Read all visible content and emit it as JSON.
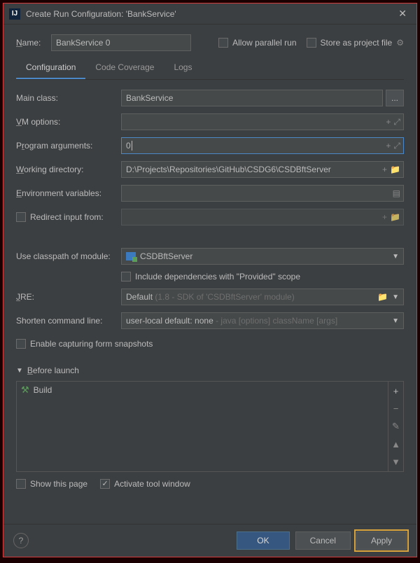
{
  "window": {
    "title": "Create Run Configuration: 'BankService'"
  },
  "header": {
    "name_label": "Name:",
    "name_value": "BankService 0",
    "allow_parallel_label": "Allow parallel run",
    "store_project_label": "Store as project file"
  },
  "tabs": {
    "items": [
      {
        "label": "Configuration",
        "active": true
      },
      {
        "label": "Code Coverage",
        "active": false
      },
      {
        "label": "Logs",
        "active": false
      }
    ]
  },
  "form": {
    "main_class_label": "Main class:",
    "main_class_value": "BankService",
    "browse_label": "...",
    "vm_options_label": "VM options:",
    "vm_options_value": "",
    "program_args_label": "Program arguments:",
    "program_args_value": "0",
    "working_dir_label": "Working directory:",
    "working_dir_value": "D:\\Projects\\Repositories\\GitHub\\CSDG6\\CSDBftServer",
    "env_vars_label": "Environment variables:",
    "env_vars_value": "",
    "redirect_input_label": "Redirect input from:",
    "classpath_label": "Use classpath of module:",
    "classpath_value": "CSDBftServer",
    "include_provided_label": "Include dependencies with \"Provided\" scope",
    "jre_label": "JRE:",
    "jre_value": "Default",
    "jre_hint": "(1.8 - SDK of 'CSDBftServer' module)",
    "shorten_label": "Shorten command line:",
    "shorten_value": "user-local default: none",
    "shorten_hint": "- java [options] className [args]",
    "enable_snapshots_label": "Enable capturing form snapshots"
  },
  "before_launch": {
    "title": "Before launch",
    "build_label": "Build"
  },
  "bottom": {
    "show_page_label": "Show this page",
    "activate_tool_label": "Activate tool window"
  },
  "footer": {
    "ok": "OK",
    "cancel": "Cancel",
    "apply": "Apply"
  }
}
